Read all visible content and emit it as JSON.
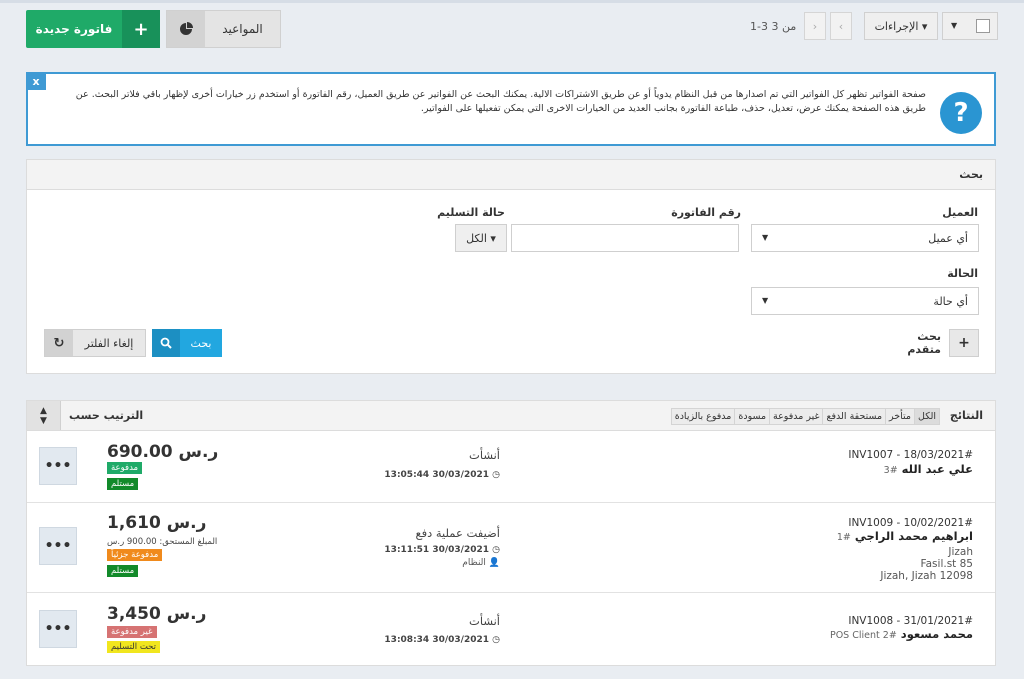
{
  "toolbar": {
    "new_invoice_label": "فاتورة جديدة",
    "appointments_label": "المواعيد",
    "pager_text": "1-3 من 3",
    "actions_label": "الإجراءات ▾"
  },
  "info": {
    "close_label": "x",
    "text": "صفحة الفواتير تظهر كل الفواتير التي تم اصدارها من قبل النظام يدوياً أو عن طريق الاشتراكات الالية. يمكنك البحث عن الفواتير عن طريق العميل، رقم الفاتورة أو استخدم زر خيارات أخرى لإظهار باقي فلاتر البحث. عن طريق هذه الصفحة يمكنك عرض، تعديل، حذف، طباعة الفاتورة بجانب العديد من الخيارات الاخرى التي يمكن تفعيلها على الفواتير."
  },
  "search": {
    "title": "بحث",
    "client_label": "العميل",
    "client_value": "أي عميل",
    "invoice_no_label": "رقم الفاتورة",
    "delivery_label": "حالة التسليم",
    "delivery_value": "الكل ▾",
    "status_label": "الحالة",
    "status_value": "أي حالة",
    "advanced_label": "بحث متقدم",
    "search_button": "بحث",
    "reset_button": "إلغاء الفلتر"
  },
  "results": {
    "title": "النتائج",
    "sort_label": "الترتيب حسب",
    "filters": [
      "الكل",
      "متأخر",
      "مستحقة الدفع",
      "غير مدفوعة",
      "مسودة",
      "مدفوع بالزيادة"
    ],
    "rows": [
      {
        "invoice": "#INV1007 - 18/03/2021",
        "client": "علي عبد الله",
        "client_no": "#3",
        "address": [],
        "action": "أنشأت",
        "time": "13:05:44 30/03/2021",
        "user": "",
        "amount": "690.00 ر.س",
        "due": "",
        "payment_badge": "مدفوعة",
        "delivery_badge": "مستلم"
      },
      {
        "invoice": "#INV1009 - 10/02/2021",
        "client": "ابراهيم محمد الراجي",
        "client_no": "#1",
        "address": [
          "Jizah",
          "Fasil.st 85",
          "Jizah, Jizah 12098"
        ],
        "action": "أضيفت عملية دفع",
        "time": "13:11:51 30/03/2021",
        "user": "النظام",
        "amount": "1,610 ر.س",
        "due": "المبلغ المستحق: 900.00 ر.س",
        "payment_badge": "مدفوعة جزئياً",
        "delivery_badge": "مستلم"
      },
      {
        "invoice": "#INV1008 - 31/01/2021",
        "client": "محمد مسعود",
        "client_no": "#2 POS Client",
        "address": [],
        "action": "أنشأت",
        "time": "13:08:34 30/03/2021",
        "user": "",
        "amount": "3,450 ر.س",
        "due": "",
        "payment_badge": "غير مدفوعة",
        "delivery_badge": "تحت التسليم"
      }
    ]
  },
  "colors": {
    "primary_green": "#1faa68",
    "info_blue": "#2a95d2",
    "search_blue": "#22a7e0"
  }
}
